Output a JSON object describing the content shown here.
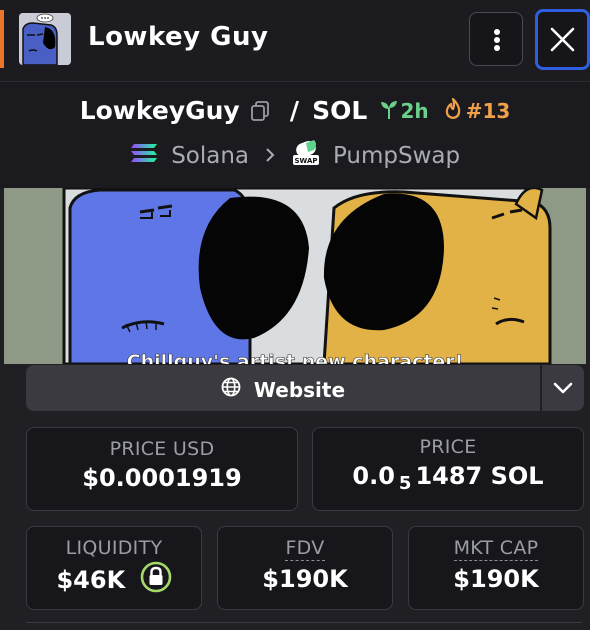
{
  "header": {
    "title": "Lowkey Guy",
    "menu_icon": "kebab-menu-icon",
    "close_icon": "close-icon",
    "accent_color": "#e8752a",
    "focus_color": "#2f5fe0"
  },
  "pair": {
    "base_token": "LowkeyGuy",
    "separator": "/",
    "quote_token": "SOL",
    "age": "2h",
    "rank": "#13",
    "age_color": "#6ccf8a",
    "rank_color": "#f0a04b"
  },
  "chain": {
    "name": "Solana",
    "dex": "PumpSwap",
    "dex_badge_text": "SWAP"
  },
  "banner": {
    "caption": "Chillguy's artist new character!"
  },
  "links": {
    "website_label": "Website"
  },
  "stats": {
    "price_usd_label": "PRICE USD",
    "price_usd_value": "$0.0001919",
    "price_label": "PRICE",
    "price_value_lead": "0.0",
    "price_value_zeros": "5",
    "price_value_digits": "1487 SOL",
    "liquidity_label": "LIQUIDITY",
    "liquidity_value": "$46K",
    "fdv_label": "FDV",
    "fdv_value": "$190K",
    "mktcap_label": "MKT CAP",
    "mktcap_value": "$190K"
  }
}
